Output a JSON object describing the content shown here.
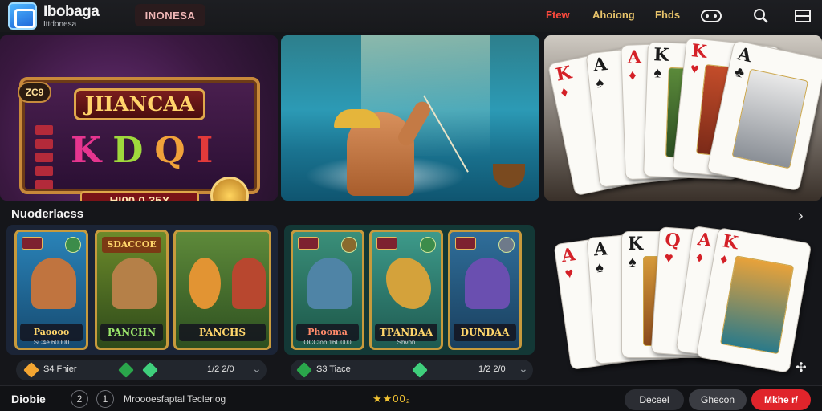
{
  "header": {
    "brand_name": "Ibobaga",
    "brand_sub": "Ittdonesa",
    "region": "INONESA",
    "nav": [
      "Ftew",
      "Ahoiong",
      "Fhds"
    ],
    "icons": [
      "gamepad-icon",
      "search-icon",
      "menu-icon"
    ]
  },
  "hero": {
    "slot_title": "JIIANCAA",
    "slot_tag": "ZC9",
    "slot_letters": [
      "K",
      "D",
      "Q",
      "I"
    ],
    "slot_payout": "HI00 0.35X"
  },
  "section": {
    "title": "Nuoderlacss",
    "more_icon": "chevron-right-icon"
  },
  "games_left": [
    {
      "title": "Paoooo",
      "sub": "SC4e 60000"
    },
    {
      "title": "PANCHN",
      "header": "SDACCOE"
    },
    {
      "title": "PANCHS"
    }
  ],
  "games_right": [
    {
      "title": "Phooma",
      "sub": "OCCtob 16C000"
    },
    {
      "title": "TPANDAA",
      "sub": "Shvon"
    },
    {
      "title": "DUNDAA"
    }
  ],
  "game_bars": [
    {
      "label": "S4 Fhier",
      "count": "1/2 2/0"
    },
    {
      "label": "S3 Tiace",
      "count": "1/2 2/0"
    }
  ],
  "footer": {
    "title": "Diobie",
    "circle1": "2",
    "circle2": "1",
    "text": "Mroooesfaptal Teclerlog",
    "stars": "★★00₂",
    "buttons": [
      "Deceel",
      "Ghecon",
      "Mkhe r/"
    ]
  },
  "colors": {
    "accent": "#e0242b",
    "gold": "#e8c46b",
    "bg": "#15161a"
  }
}
